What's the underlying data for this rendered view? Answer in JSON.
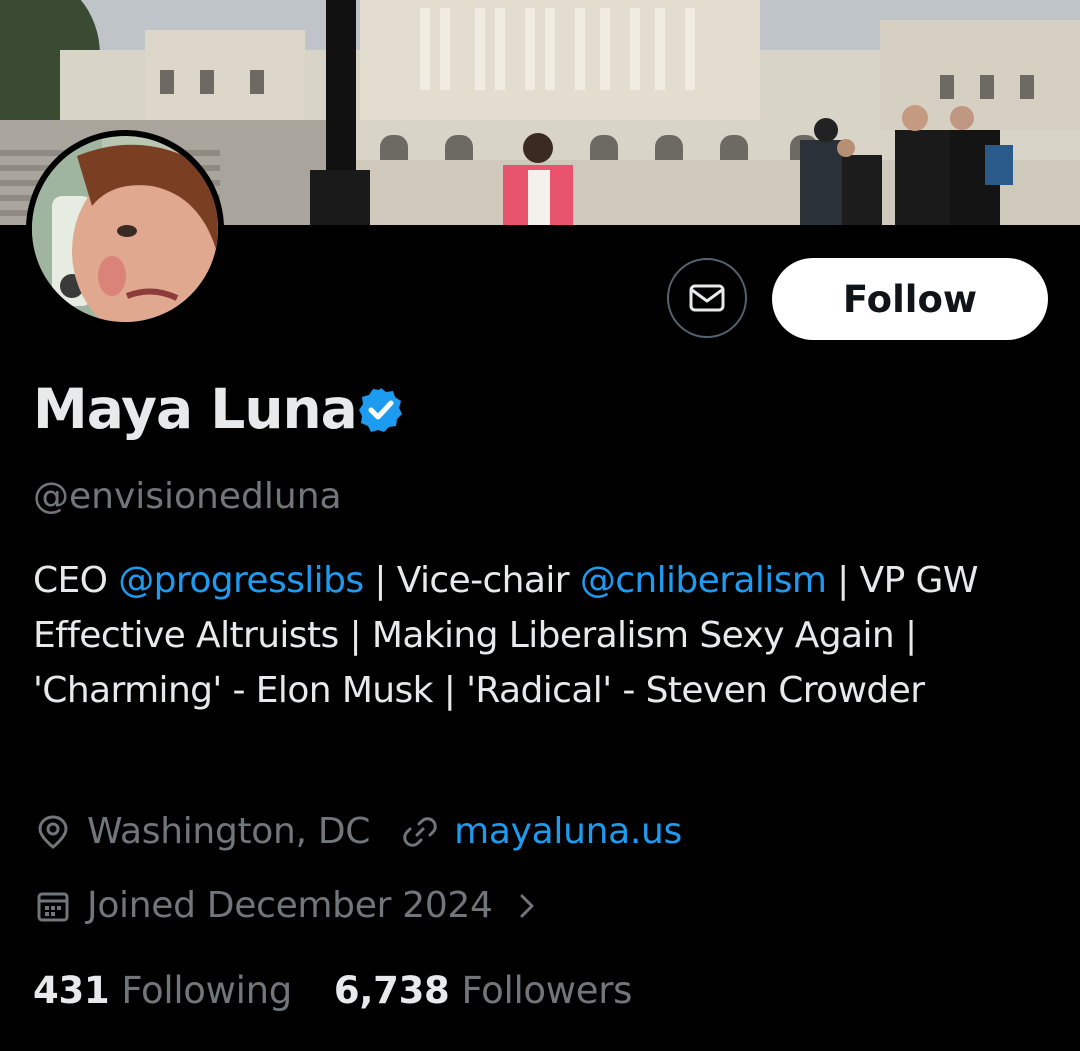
{
  "profile": {
    "display_name": "Maya Luna",
    "handle": "@envisionedluna",
    "bio": {
      "p1": "CEO ",
      "mention1": "@progresslibs",
      "p2": " | Vice-chair ",
      "mention2": "@cnliberalism",
      "p3": " | VP GW Effective Altruists |  Making Liberalism Sexy Again | 'Charming' - Elon Musk | 'Radical' - Steven Crowder"
    },
    "location": "Washington, DC",
    "website": "mayaluna.us",
    "joined": "Joined December 2024",
    "following_count": "431",
    "following_label": "Following",
    "followers_count": "6,738",
    "followers_label": "Followers"
  },
  "actions": {
    "follow_label": "Follow"
  },
  "icons": {
    "message": "envelope-icon",
    "verified": "verified-badge-icon",
    "location": "location-pin-icon",
    "link": "link-icon",
    "calendar": "calendar-icon",
    "chevron": "chevron-right-icon"
  },
  "colors": {
    "background": "#000000",
    "text": "#e7e9ea",
    "muted": "#71767b",
    "accent": "#1d9bf0"
  }
}
